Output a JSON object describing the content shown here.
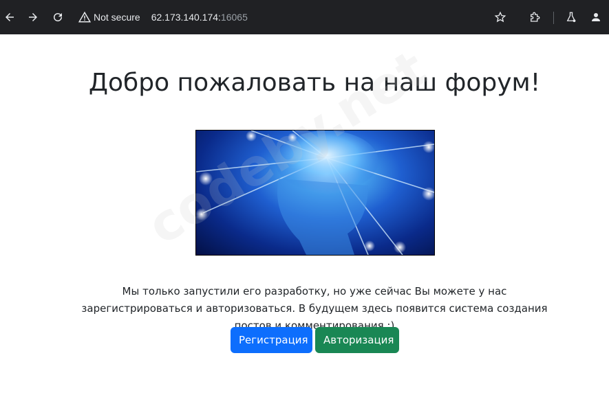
{
  "browser": {
    "security_label": "Not secure",
    "url_host": "62.173.140.174:",
    "url_port": "16065"
  },
  "page": {
    "title": "Добро пожаловать на наш форум!",
    "description": "Мы только запустили его разработку, но уже сейчас Вы можете у нас зарегистрироваться и авторизоваться. В будущем здесь появится система создания постов и комментирования :)",
    "register_button": "Регистрация",
    "login_button": "Авторизация",
    "watermark": "codeby.net"
  },
  "colors": {
    "primary": "#0d6efd",
    "success": "#198754",
    "toolbar": "#202124"
  },
  "icons": [
    "back-icon",
    "forward-icon",
    "reload-icon",
    "warning-icon",
    "star-icon",
    "extensions-icon",
    "labs-icon",
    "profile-icon"
  ]
}
